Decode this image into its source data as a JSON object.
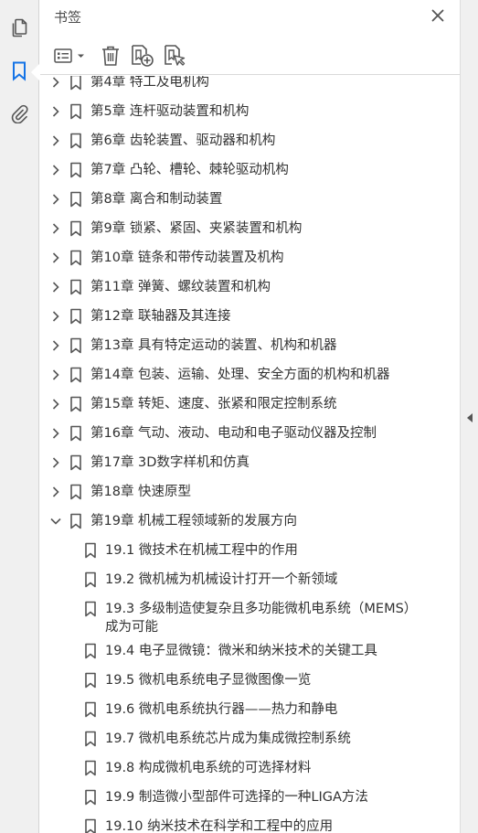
{
  "panel": {
    "title": "书签"
  },
  "rail": {
    "icons": [
      "pages-icon",
      "bookmark-icon",
      "attachment-icon"
    ],
    "accent": "#1473e6"
  },
  "toolbar": {
    "icons": [
      "options-menu-icon",
      "delete-icon",
      "new-bookmark-icon",
      "bookmark-from-selection-icon"
    ]
  },
  "bookmarks": [
    {
      "level": 0,
      "expanded": false,
      "label": "第4章  特工及电机构"
    },
    {
      "level": 0,
      "expanded": false,
      "label": "第5章  连杆驱动装置和机构"
    },
    {
      "level": 0,
      "expanded": false,
      "label": "第6章  齿轮装置、驱动器和机构"
    },
    {
      "level": 0,
      "expanded": false,
      "label": "第7章  凸轮、槽轮、棘轮驱动机构"
    },
    {
      "level": 0,
      "expanded": false,
      "label": "第8章  离合和制动装置"
    },
    {
      "level": 0,
      "expanded": false,
      "label": "第9章  锁紧、紧固、夹紧装置和机构"
    },
    {
      "level": 0,
      "expanded": false,
      "label": "第10章  链条和带传动装置及机构"
    },
    {
      "level": 0,
      "expanded": false,
      "label": "第11章  弹簧、螺纹装置和机构"
    },
    {
      "level": 0,
      "expanded": false,
      "label": "第12章  联轴器及其连接"
    },
    {
      "level": 0,
      "expanded": false,
      "label": "第13章  具有特定运动的装置、机构和机器"
    },
    {
      "level": 0,
      "expanded": false,
      "label": "第14章  包装、运输、处理、安全方面的机构和机器"
    },
    {
      "level": 0,
      "expanded": false,
      "label": "第15章  转矩、速度、张紧和限定控制系统"
    },
    {
      "level": 0,
      "expanded": false,
      "label": "第16章  气动、液动、电动和电子驱动仪器及控制"
    },
    {
      "level": 0,
      "expanded": false,
      "label": "第17章  3D数字样机和仿真"
    },
    {
      "level": 0,
      "expanded": false,
      "label": "第18章  快速原型"
    },
    {
      "level": 0,
      "expanded": true,
      "label": "第19章  机械工程领域新的发展方向"
    },
    {
      "level": 1,
      "label": "19.1  微技术在机械工程中的作用"
    },
    {
      "level": 1,
      "label": "19.2  微机械为机械设计打开一个新领域"
    },
    {
      "level": 1,
      "label": "19.3  多级制造使复杂且多功能微机电系统（MEMS）成为可能"
    },
    {
      "level": 1,
      "label": "19.4  电子显微镜：微米和纳米技术的关键工具"
    },
    {
      "level": 1,
      "label": "19.5  微机电系统电子显微图像一览"
    },
    {
      "level": 1,
      "label": "19.6  微机电系统执行器——热力和静电"
    },
    {
      "level": 1,
      "label": "19.7  微机电系统芯片成为集成微控制系统"
    },
    {
      "level": 1,
      "label": "19.8  构成微机电系统的可选择材料"
    },
    {
      "level": 1,
      "label": "19.9  制造微小型部件可选择的一种LIGA方法"
    },
    {
      "level": 1,
      "label": "19.10  纳米技术在科学和工程中的应用"
    }
  ]
}
